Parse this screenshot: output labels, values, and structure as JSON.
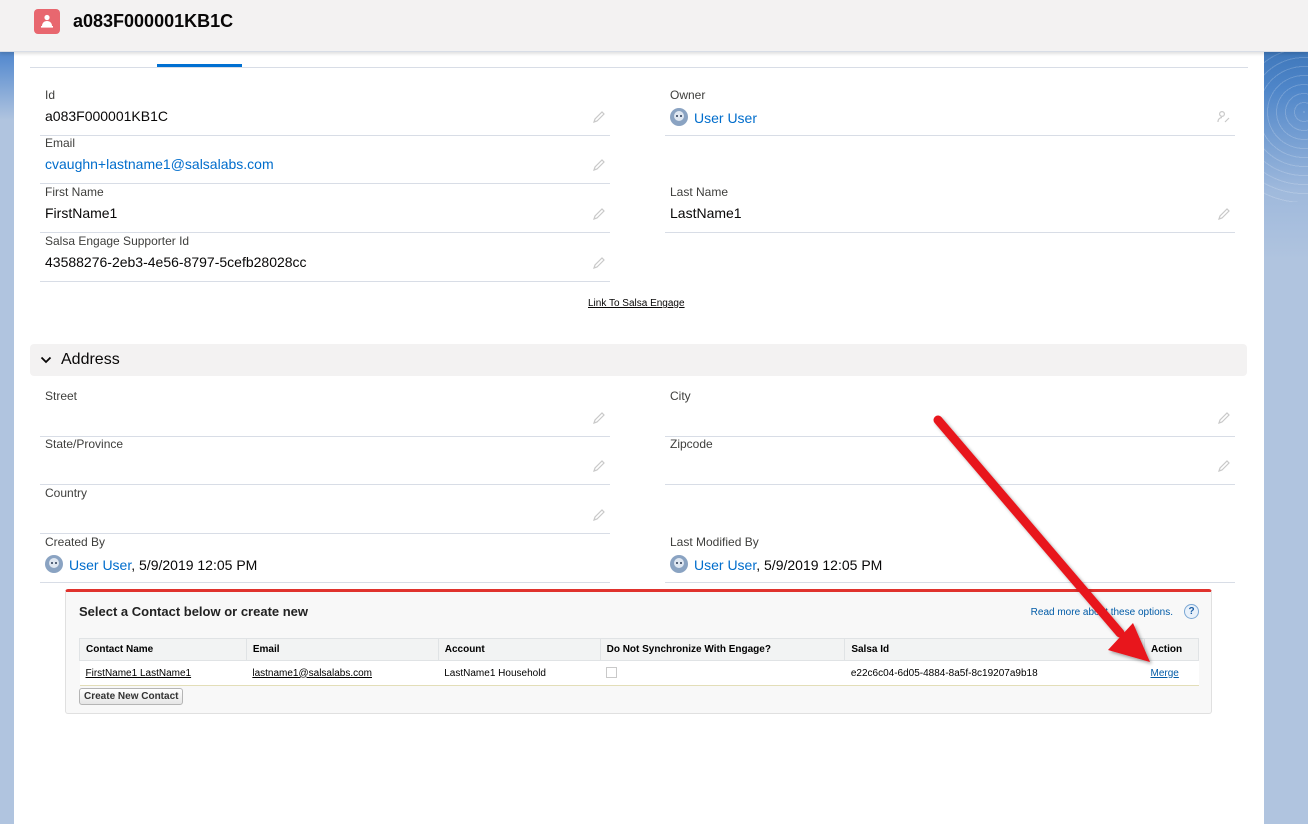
{
  "header": {
    "title": "a083F000001KB1C",
    "icon": "supporter-record-icon"
  },
  "fields": {
    "id": {
      "label": "Id",
      "value": "a083F000001KB1C"
    },
    "owner": {
      "label": "Owner",
      "value": "User User"
    },
    "email": {
      "label": "Email",
      "value": "cvaughn+lastname1@salsalabs.com"
    },
    "first_name": {
      "label": "First Name",
      "value": "FirstName1"
    },
    "last_name": {
      "label": "Last Name",
      "value": "LastName1"
    },
    "supporter_id": {
      "label": "Salsa Engage Supporter Id",
      "value": "43588276-2eb3-4e56-8797-5cefb28028cc"
    }
  },
  "engage_link": "Link To Salsa Engage",
  "address_section": {
    "title": "Address",
    "street": {
      "label": "Street",
      "value": ""
    },
    "city": {
      "label": "City",
      "value": ""
    },
    "state": {
      "label": "State/Province",
      "value": ""
    },
    "zipcode": {
      "label": "Zipcode",
      "value": ""
    },
    "country": {
      "label": "Country",
      "value": ""
    },
    "created_by": {
      "label": "Created By",
      "user": "User User",
      "date": ", 5/9/2019 12:05 PM"
    },
    "last_modified_by": {
      "label": "Last Modified By",
      "user": "User User",
      "date": ", 5/9/2019 12:05 PM"
    }
  },
  "contact_panel": {
    "title": "Select a Contact below or create new",
    "help_link": "Read more about these options.",
    "help_icon": "?",
    "columns": [
      "Contact Name",
      "Email",
      "Account",
      "Do Not Synchronize With Engage?",
      "Salsa Id",
      "Action"
    ],
    "rows": [
      {
        "contact_name": "FirstName1 LastName1",
        "email": "lastname1@salsalabs.com",
        "account": "LastName1 Household",
        "do_not_sync": false,
        "salsa_id": "e22c6c04-6d05-4884-8a5f-8c19207a9b18",
        "action": "Merge"
      }
    ],
    "create_button": "Create New Contact"
  },
  "colors": {
    "link": "#006dcc",
    "accent": "#0070d2",
    "panel_border": "#e0322d",
    "annotation_arrow": "#e8131b",
    "header_icon": "#e8676f"
  }
}
